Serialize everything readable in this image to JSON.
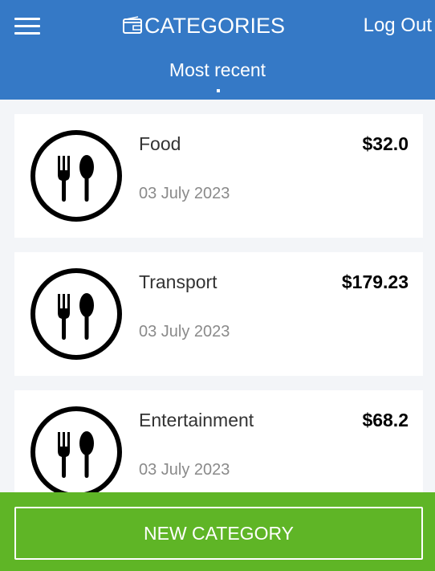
{
  "header": {
    "title": "CATEGORIES",
    "logout_label": "Log Out",
    "tab_label": "Most recent",
    "background_color": "#3579c6"
  },
  "categories": [
    {
      "name": "Food",
      "date": "03 July 2023",
      "amount": "$32.0",
      "icon": "utensils-icon"
    },
    {
      "name": "Transport",
      "date": "03 July 2023",
      "amount": "$179.23",
      "icon": "utensils-icon"
    },
    {
      "name": "Entertainment",
      "date": "03 July 2023",
      "amount": "$68.2",
      "icon": "utensils-icon"
    }
  ],
  "footer": {
    "new_category_label": "NEW CATEGORY",
    "background_color": "#5fb526"
  }
}
